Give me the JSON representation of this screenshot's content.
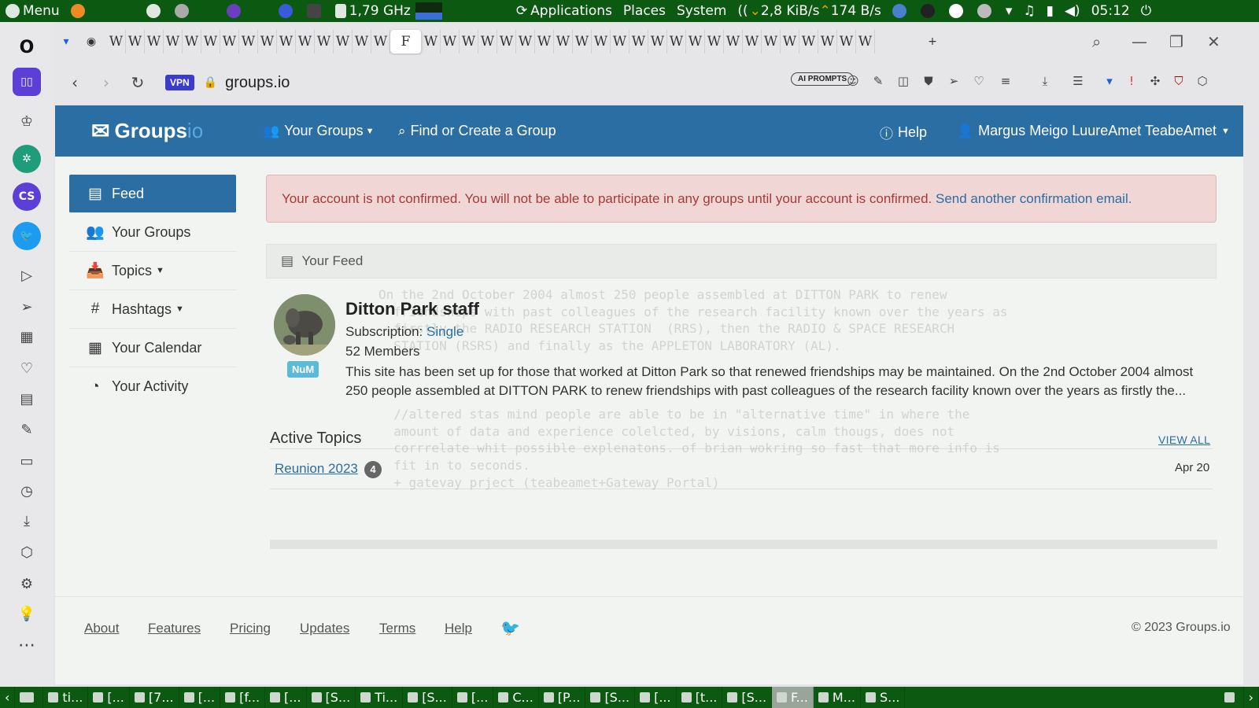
{
  "os_top_panel": {
    "menu_label": "Menu",
    "cpu_freq": "1,79 GHz",
    "applications_label": "Applications",
    "places_label": "Places",
    "system_label": "System",
    "net_down": "2,8 KiB/s",
    "net_up": "174 B/s",
    "clock": "05:12"
  },
  "browser": {
    "wiki_tab_glyph": "W",
    "active_tab_label": "F",
    "vpn_label": "VPN",
    "url": "groups.io",
    "ai_prompts_label": "AI PROMPTS"
  },
  "groups_nav": {
    "logo_text": "Groups",
    "logo_suffix": "io",
    "your_groups": "Your Groups",
    "find_create": "Find or Create a Group",
    "help": "Help",
    "user": "Margus Meigo LuureAmet TeabeAmet"
  },
  "left_nav": [
    {
      "label": "Feed",
      "icon": "newspaper-icon"
    },
    {
      "label": "Your Groups",
      "icon": "users-icon"
    },
    {
      "label": "Topics",
      "icon": "inbox-icon"
    },
    {
      "label": "Hashtags",
      "icon": "hash-icon"
    },
    {
      "label": "Your Calendar",
      "icon": "calendar-icon"
    },
    {
      "label": "Your Activity",
      "icon": "dashboard-icon"
    }
  ],
  "alert": {
    "message": "Your account is not confirmed. You will not be able to participate in any groups until your account is confirmed.",
    "link": "Send another confirmation email."
  },
  "feed": {
    "header": "Your Feed",
    "group": {
      "title": "Ditton Park staff",
      "subscription_label": "Subscription:",
      "subscription_value": "Single",
      "members": "52 Members",
      "badge": "NuM",
      "description": "This site has been set up for those that worked at Ditton Park so that renewed friendships may be maintained. On the 2nd October 2004 almost 250 people assembled at DITTON PARK to renew friendships with past colleagues of the research facility known over the years as firstly the..."
    },
    "active_topics": {
      "title": "Active Topics",
      "view_all": "VIEW ALL",
      "topics": [
        {
          "title": "Reunion 2023",
          "count": "4",
          "date": "Apr 20"
        }
      ]
    }
  },
  "footer": {
    "about": "About",
    "features": "Features",
    "pricing": "Pricing",
    "updates": "Updates",
    "terms": "Terms",
    "help": "Help",
    "copyright": "© 2023 Groups.io"
  },
  "taskbar": [
    {
      "label": "ti..."
    },
    {
      "label": "[..."
    },
    {
      "label": "[7..."
    },
    {
      "label": "[..."
    },
    {
      "label": "[f..."
    },
    {
      "label": "[..."
    },
    {
      "label": "[S..."
    },
    {
      "label": "Ti..."
    },
    {
      "label": "[S..."
    },
    {
      "label": "[..."
    },
    {
      "label": "C..."
    },
    {
      "label": "[P..."
    },
    {
      "label": "[S..."
    },
    {
      "label": "[..."
    },
    {
      "label": "[t..."
    },
    {
      "label": "[S..."
    },
    {
      "label": "F..."
    },
    {
      "label": "M..."
    },
    {
      "label": "S..."
    }
  ],
  "ghost_text": "On the 2nd October 2004 almost 250 people assembled at DITTON PARK to renew\n  friendships with past colleagues of the research facility known over the years as\n  firstly the RADIO RESEARCH STATION  (RRS), then the RADIO & SPACE RESEARCH\n  STATION (RSRS) and finally as the APPLETON LABORATORY (AL).\n\n\n\n  //altered stas mind people are able to be in \"alternative time\" in where the\n  amount of data and experience colelcted, by visions, calm thougs, does not\n  corrrelate whit possible explenatons. of brian wokring so fast that more info is\n  fit in to seconds.\n  + gatevay prject (teabeamet+Gateway Portal)"
}
